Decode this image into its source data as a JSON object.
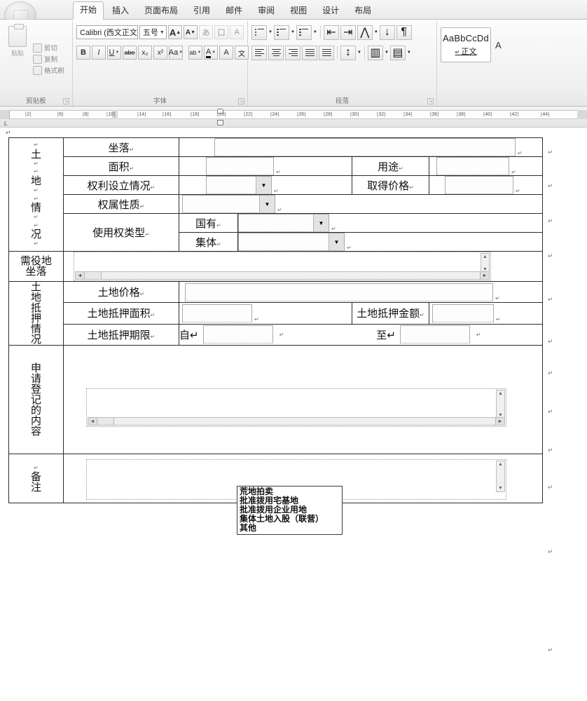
{
  "app": {
    "office_button": "office-button"
  },
  "ribbon": {
    "tabs": [
      {
        "label": "开始",
        "active": true
      },
      {
        "label": "插入",
        "active": false
      },
      {
        "label": "页面布局",
        "active": false
      },
      {
        "label": "引用",
        "active": false
      },
      {
        "label": "邮件",
        "active": false
      },
      {
        "label": "审阅",
        "active": false
      },
      {
        "label": "视图",
        "active": false
      },
      {
        "label": "设计",
        "active": false
      },
      {
        "label": "布局",
        "active": false
      }
    ],
    "clipboard": {
      "group_label": "剪贴板",
      "paste_label": "粘贴",
      "cut_label": "剪切",
      "copy_label": "复制",
      "format_painter_label": "格式刷"
    },
    "font": {
      "group_label": "字体",
      "font_name": "Calibri (西文正文)",
      "font_size": "五号",
      "grow_font": "A",
      "shrink_font": "A",
      "bold": "B",
      "italic": "I",
      "underline": "U",
      "strikethrough": "abe",
      "subscript": "x₂",
      "superscript": "x²",
      "change_case": "Aa",
      "highlight": "ab",
      "font_color": "A",
      "text_effect": "A",
      "phonetic": "文"
    },
    "paragraph": {
      "group_label": "段落"
    },
    "styles": {
      "sample": "AaBbCcDd",
      "name": "正文",
      "next_sample": "A"
    }
  },
  "ruler": {
    "ticks": [
      "2",
      "6",
      "8",
      "10",
      "14",
      "16",
      "18",
      "20",
      "22",
      "24",
      "26",
      "28",
      "30",
      "32",
      "34",
      "36",
      "38",
      "40",
      "42",
      "44"
    ]
  },
  "document": {
    "paragraph_mark": "↵",
    "sections": {
      "land_info": {
        "vertical_label": "土 地 情 况",
        "vertical_chars": [
          "土",
          "地",
          "情",
          "况"
        ]
      },
      "servient": {
        "vertical_label": "需役地坐落",
        "lines": [
          "需役地",
          "坐落"
        ]
      },
      "mortgage": {
        "vertical_label": "土地抵押情况",
        "vertical_chars": [
          "土",
          "地",
          "抵",
          "押",
          "情",
          "况"
        ]
      },
      "apply_content": {
        "vertical_label": "申请登记的内容",
        "vertical_chars": [
          "申",
          "请",
          "登",
          "记",
          "的",
          "内",
          "容"
        ]
      },
      "remark": {
        "vertical_label": "备注",
        "vertical_chars": [
          "备",
          "注"
        ]
      }
    },
    "rows": {
      "location_label": "坐落",
      "area_label": "面积",
      "usage_label": "用途",
      "right_establish_label": "权利设立情况",
      "acquire_price_label": "取得价格",
      "ownership_nature_label": "权属性质",
      "use_right_type_label": "使用权类型",
      "state_owned_label": "国有",
      "collective_label": "集体",
      "land_price_label": "土地价格",
      "mortgage_area_label": "土地抵押面积",
      "mortgage_amount_label": "土地抵押金额",
      "mortgage_term_label": "土地抵押期限",
      "from_label": "自",
      "to_label": "至"
    },
    "fields": {
      "location_value": "",
      "area_value": "",
      "usage_value": "",
      "right_establish_value": "",
      "acquire_price_value": "",
      "ownership_nature_value": "",
      "state_owned_value": "",
      "collective_value": "",
      "servient_value": "",
      "land_price_value": "",
      "mortgage_area_value": "",
      "mortgage_amount_value": "",
      "mortgage_from_value": "",
      "mortgage_to_value": "",
      "apply_content_value": "",
      "remark_value": ""
    }
  },
  "dropdown": {
    "open_for": "集体",
    "options": [
      "荒地拍卖",
      "批准拨用宅基地",
      "批准拨用企业用地",
      "集体土地入股（联营）",
      "其他"
    ]
  }
}
